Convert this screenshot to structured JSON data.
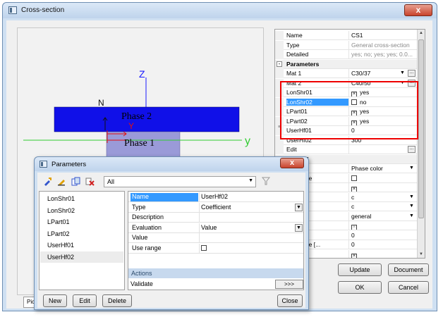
{
  "main_window": {
    "title": "Cross-section",
    "close_glyph": "x"
  },
  "viewport": {
    "z_label": "Z",
    "y_label": "y",
    "n_label": "N",
    "local_y_label": "Y",
    "phase2_label": "Phase 2",
    "phase1_label": "Phase 1",
    "bottom_tab": "Pic",
    "colors": {
      "phase2": "#1010e8",
      "phase1": "#9a9ad8",
      "z_axis": "#1a1aff",
      "y_axis": "#33cc33",
      "local": "#e01010"
    }
  },
  "properties": {
    "rows": [
      {
        "name": "Name",
        "value": "CS1",
        "kind": "text"
      },
      {
        "name": "Type",
        "value": "General cross-section",
        "kind": "grey"
      },
      {
        "name": "Detailed",
        "value": "yes; no; yes; yes; 0.0...",
        "kind": "grey"
      },
      {
        "name": "Parameters",
        "value": "",
        "kind": "section",
        "expander": "-"
      },
      {
        "name": "Mat 1",
        "value": "C30/37",
        "kind": "dropdown-ellipsis"
      },
      {
        "name": "Mat 2",
        "value": "C40/50",
        "kind": "dropdown-ellipsis"
      },
      {
        "name": "LonShr01",
        "value": "yes",
        "kind": "check",
        "checked": true
      },
      {
        "name": "LonShr02",
        "value": "no",
        "kind": "check",
        "checked": false,
        "selected": true
      },
      {
        "name": "LPart01",
        "value": "yes",
        "kind": "check",
        "checked": true
      },
      {
        "name": "LPart02",
        "value": "yes",
        "kind": "check",
        "checked": true
      },
      {
        "name": "UserHf01",
        "value": "0",
        "kind": "text"
      },
      {
        "name": "UserHf02",
        "value": "300",
        "kind": "text"
      },
      {
        "name": "Edit",
        "value": "",
        "kind": "ellipsis"
      },
      {
        "name": "General",
        "value": "",
        "kind": "section",
        "expander": "-"
      },
      {
        "name": "or",
        "value": "Phase color",
        "kind": "dropdown"
      },
      {
        "name": "s editable",
        "value": "",
        "kind": "check",
        "checked": false
      },
      {
        "name": "editable",
        "value": "",
        "kind": "check",
        "checked": true
      },
      {
        "name": "y-y",
        "value": "c",
        "kind": "dropdown"
      },
      {
        "name": "z-z",
        "value": "c",
        "kind": "dropdown"
      },
      {
        "name": "en",
        "value": "general",
        "kind": "dropdown"
      },
      {
        "name": "lysis",
        "value": "",
        "kind": "check",
        "checked": true,
        "grey": true
      },
      {
        "name": "e [mm]",
        "value": "0",
        "kind": "text"
      },
      {
        "name": "t distance [...",
        "value": "0",
        "kind": "text"
      },
      {
        "name": "lculation",
        "value": "",
        "kind": "check",
        "checked": true
      }
    ],
    "ellipsis": "...",
    "check_glyph": "⊠"
  },
  "buttons": {
    "update": "Update",
    "document": "Document",
    "ok": "OK",
    "cancel": "Cancel"
  },
  "param_dialog": {
    "title": "Parameters",
    "close_glyph": "x",
    "filter_value": "All",
    "list": [
      "LonShr01",
      "LonShr02",
      "LPart01",
      "LPart02",
      "UserHf01",
      "UserHf02"
    ],
    "selected_index": 5,
    "props": [
      {
        "name": "Name",
        "value": "UserHf02",
        "selected": true
      },
      {
        "name": "Type",
        "value": "Coefficient",
        "dropdown": true
      },
      {
        "name": "Description",
        "value": ""
      },
      {
        "name": "Evaluation",
        "value": "Value",
        "dropdown": true
      },
      {
        "name": "Value",
        "value": ""
      },
      {
        "name": "Use range",
        "value": "",
        "checkbox": true
      }
    ],
    "actions_header": "Actions",
    "validate_label": "Validate",
    "validate_button": ">>>",
    "buttons": {
      "new": "New",
      "edit": "Edit",
      "delete": "Delete",
      "close": "Close"
    }
  }
}
